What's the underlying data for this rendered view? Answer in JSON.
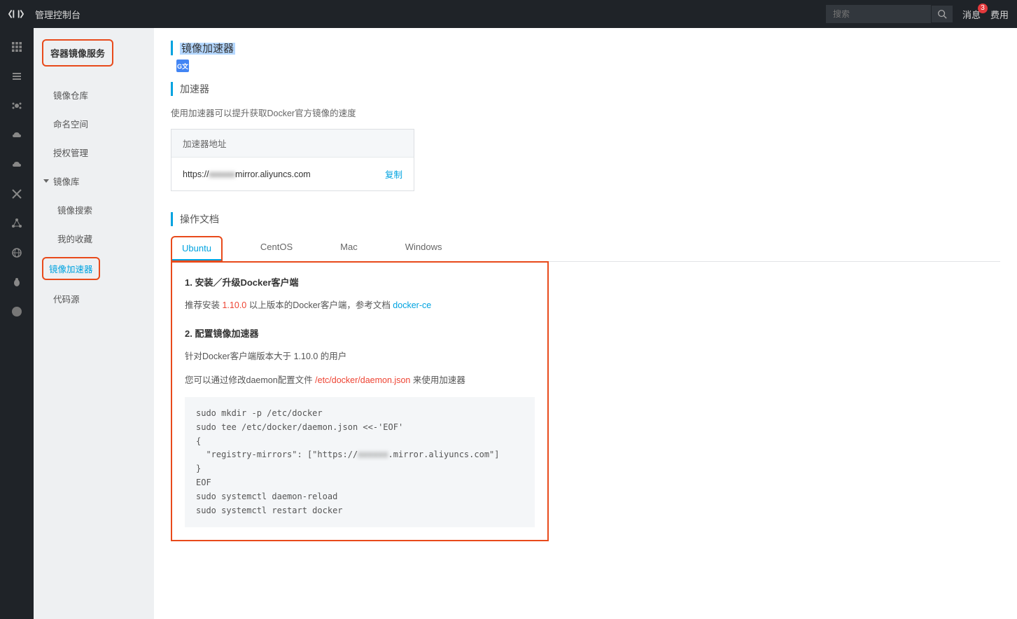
{
  "topbar": {
    "title": "管理控制台",
    "search_placeholder": "搜索",
    "notif_label": "消息",
    "notif_count": "3",
    "cost_label": "费用"
  },
  "sidenav": {
    "title": "容器镜像服务",
    "items": {
      "repo": "镜像仓库",
      "namespace": "命名空间",
      "auth": "授权管理",
      "library": "镜像库",
      "search": "镜像搜索",
      "fav": "我的收藏",
      "accel": "镜像加速器",
      "source": "代码源"
    }
  },
  "page": {
    "title": "镜像加速器",
    "section1_title": "加速器",
    "section1_desc": "使用加速器可以提升获取Docker官方镜像的速度",
    "accel_box": {
      "header": "加速器地址",
      "url_prefix": "https://",
      "url_mid_blur": "xxxxxx",
      "url_suffix": "mirror.aliyuncs.com",
      "copy": "复制"
    },
    "section2_title": "操作文档",
    "tabs": {
      "ubuntu": "Ubuntu",
      "centos": "CentOS",
      "mac": "Mac",
      "windows": "Windows"
    },
    "doc": {
      "h1": "1. 安装／升级Docker客户端",
      "p1_a": "推荐安装 ",
      "p1_ver": "1.10.0",
      "p1_b": " 以上版本的Docker客户端，参考文档 ",
      "p1_link": "docker-ce",
      "h2": "2. 配置镜像加速器",
      "p2": "针对Docker客户端版本大于 1.10.0 的用户",
      "p3_a": "您可以通过修改daemon配置文件 ",
      "p3_path": "/etc/docker/daemon.json",
      "p3_b": " 来使用加速器",
      "code_l1": "sudo mkdir -p /etc/docker",
      "code_l2": "sudo tee /etc/docker/daemon.json <<-'EOF'",
      "code_l3": "{",
      "code_l4a": "  \"registry-mirrors\": [\"https://",
      "code_l4blur": "xxxxxx",
      "code_l4b": ".mirror.aliyuncs.com\"]",
      "code_l5": "}",
      "code_l6": "EOF",
      "code_l7": "sudo systemctl daemon-reload",
      "code_l8": "sudo systemctl restart docker"
    }
  }
}
